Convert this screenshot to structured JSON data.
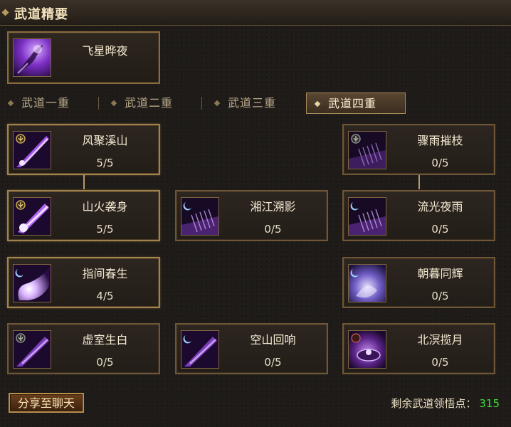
{
  "title": "武道精要",
  "header_skill": {
    "name": "飞星晔夜",
    "icon": "purple-meteor-icon"
  },
  "tabs": [
    {
      "label": "武道一重",
      "selected": false
    },
    {
      "label": "武道二重",
      "selected": false
    },
    {
      "label": "武道三重",
      "selected": false
    },
    {
      "label": "武道四重",
      "selected": true
    }
  ],
  "skills": [
    {
      "name": "风聚溪山",
      "level": "5/5",
      "icon": "purple-comet-icon"
    },
    {
      "name": "骤雨摧枝",
      "level": "0/5",
      "icon": "purple-rain-icon"
    },
    {
      "name": "山火袭身",
      "level": "5/5",
      "icon": "purple-comet-icon"
    },
    {
      "name": "湘江溯影",
      "level": "0/5",
      "icon": "purple-rain-icon"
    },
    {
      "name": "流光夜雨",
      "level": "0/5",
      "icon": "purple-rain-icon"
    },
    {
      "name": "指间春生",
      "level": "4/5",
      "icon": "purple-orb-icon"
    },
    {
      "name": "朝暮同辉",
      "level": "0/5",
      "icon": "purple-swirl-icon"
    },
    {
      "name": "虚室生白",
      "level": "0/5",
      "icon": "purple-comet-icon"
    },
    {
      "name": "空山回响",
      "level": "0/5",
      "icon": "purple-comet-icon"
    },
    {
      "name": "北溟揽月",
      "level": "0/5",
      "icon": "purple-moon-icon"
    }
  ],
  "share_button": "分享至聊天",
  "points_label": "剩余武道领悟点：",
  "points_value": "315"
}
